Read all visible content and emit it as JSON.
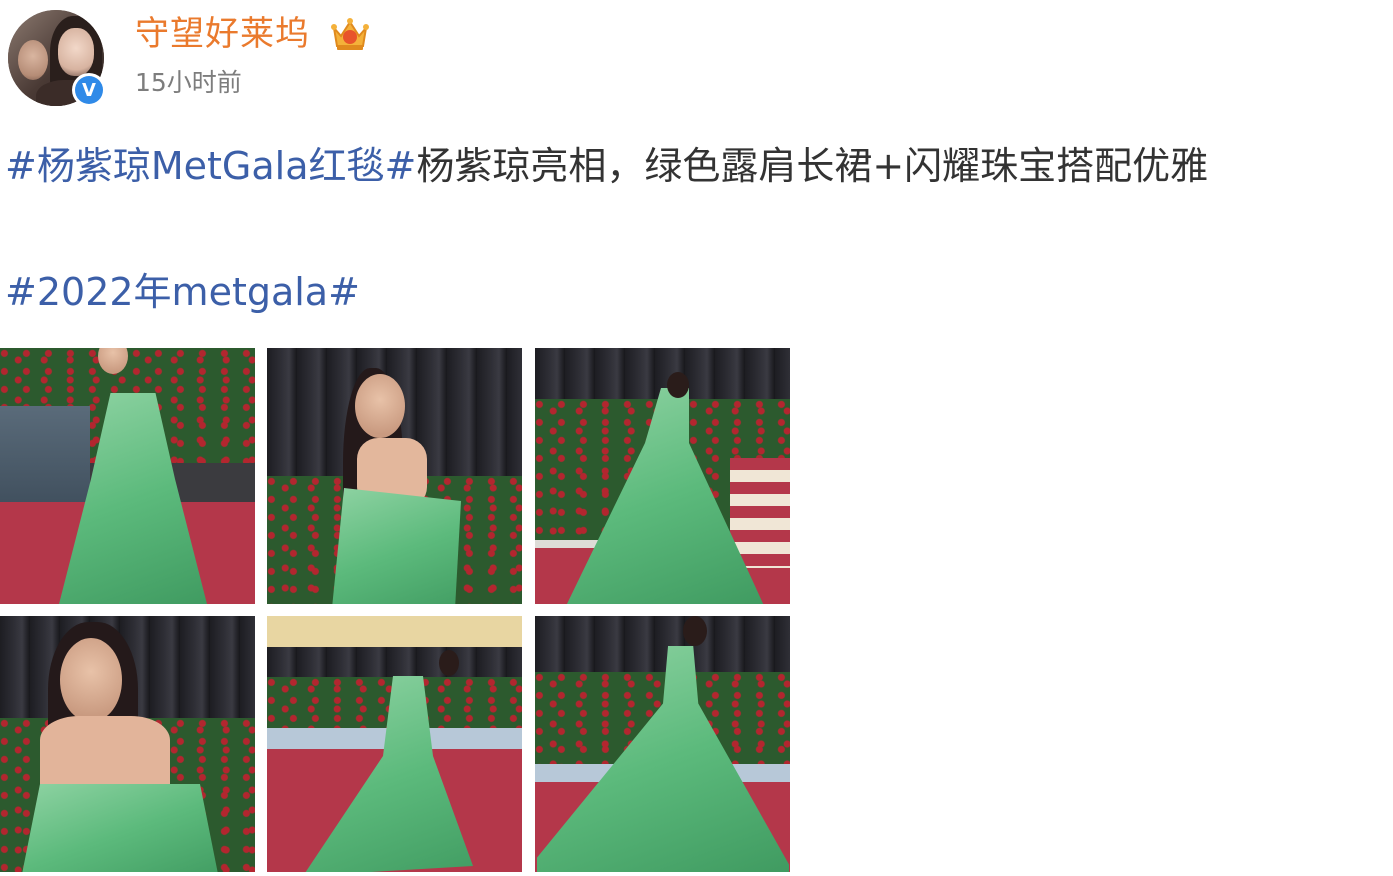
{
  "post": {
    "username": "守望好莱坞",
    "time": "15小时前",
    "text_hashtag1": "#杨紫琼MetGala红毯#",
    "text_body": "杨紫琼亮相，绿色露肩长裙+闪耀珠宝搭配优雅",
    "text_hashtag2": "#2022年metgala#"
  },
  "icons": {
    "avatar": "avatar",
    "verified": "verified-badge-icon",
    "crown": "crown-icon",
    "verified_glyph": "V"
  },
  "colors": {
    "username": "#ea7a2d",
    "hashtag": "#3c5fa8",
    "verified": "#2f8ae8",
    "dress_green": "#5cba7c"
  },
  "photos": [
    {
      "name": "photo-1"
    },
    {
      "name": "photo-2"
    },
    {
      "name": "photo-3"
    },
    {
      "name": "photo-4"
    },
    {
      "name": "photo-5"
    },
    {
      "name": "photo-6"
    }
  ]
}
